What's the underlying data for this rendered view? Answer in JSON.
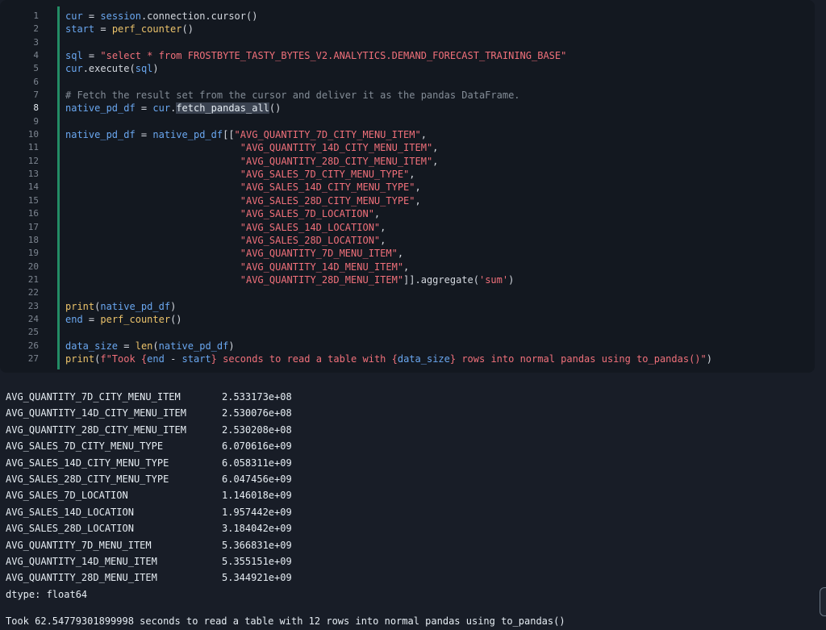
{
  "code_cell": {
    "line_numbers": [
      "1",
      "2",
      "3",
      "4",
      "5",
      "6",
      "7",
      "8",
      "9",
      "10",
      "11",
      "12",
      "13",
      "14",
      "15",
      "16",
      "17",
      "18",
      "19",
      "20",
      "21",
      "22",
      "23",
      "24",
      "25",
      "26",
      "27"
    ],
    "active_line": "8",
    "lines": [
      [
        {
          "t": "cur",
          "c": "var"
        },
        {
          "t": " = ",
          "c": "op"
        },
        {
          "t": "session",
          "c": "var"
        },
        {
          "t": ".connection.cursor()",
          "c": "op"
        }
      ],
      [
        {
          "t": "start",
          "c": "var"
        },
        {
          "t": " = ",
          "c": "op"
        },
        {
          "t": "perf_counter",
          "c": "fn"
        },
        {
          "t": "()",
          "c": "op"
        }
      ],
      [],
      [
        {
          "t": "sql",
          "c": "var"
        },
        {
          "t": " = ",
          "c": "op"
        },
        {
          "t": "\"select * from FROSTBYTE_TASTY_BYTES_V2.ANALYTICS.DEMAND_FORECAST_TRAINING_BASE\"",
          "c": "str"
        }
      ],
      [
        {
          "t": "cur",
          "c": "var"
        },
        {
          "t": ".execute(",
          "c": "op"
        },
        {
          "t": "sql",
          "c": "var"
        },
        {
          "t": ")",
          "c": "op"
        }
      ],
      [],
      [
        {
          "t": "# Fetch the result set from the cursor and deliver it as the pandas DataFrame.",
          "c": "cmt"
        }
      ],
      [
        {
          "t": "native_pd_df",
          "c": "var"
        },
        {
          "t": " = ",
          "c": "op"
        },
        {
          "t": "cur",
          "c": "var"
        },
        {
          "t": ".",
          "c": "op"
        },
        {
          "t": "fetch_pandas_all",
          "c": "hl"
        },
        {
          "t": "()",
          "c": "op"
        }
      ],
      [],
      [
        {
          "t": "native_pd_df",
          "c": "var"
        },
        {
          "t": " = ",
          "c": "op"
        },
        {
          "t": "native_pd_df",
          "c": "var"
        },
        {
          "t": "[[",
          "c": "op"
        },
        {
          "t": "\"AVG_QUANTITY_7D_CITY_MENU_ITEM\"",
          "c": "str"
        },
        {
          "t": ",",
          "c": "op"
        }
      ],
      [
        {
          "t": "                              ",
          "c": "op"
        },
        {
          "t": "\"AVG_QUANTITY_14D_CITY_MENU_ITEM\"",
          "c": "str"
        },
        {
          "t": ",",
          "c": "op"
        }
      ],
      [
        {
          "t": "                              ",
          "c": "op"
        },
        {
          "t": "\"AVG_QUANTITY_28D_CITY_MENU_ITEM\"",
          "c": "str"
        },
        {
          "t": ",",
          "c": "op"
        }
      ],
      [
        {
          "t": "                              ",
          "c": "op"
        },
        {
          "t": "\"AVG_SALES_7D_CITY_MENU_TYPE\"",
          "c": "str"
        },
        {
          "t": ",",
          "c": "op"
        }
      ],
      [
        {
          "t": "                              ",
          "c": "op"
        },
        {
          "t": "\"AVG_SALES_14D_CITY_MENU_TYPE\"",
          "c": "str"
        },
        {
          "t": ",",
          "c": "op"
        }
      ],
      [
        {
          "t": "                              ",
          "c": "op"
        },
        {
          "t": "\"AVG_SALES_28D_CITY_MENU_TYPE\"",
          "c": "str"
        },
        {
          "t": ",",
          "c": "op"
        }
      ],
      [
        {
          "t": "                              ",
          "c": "op"
        },
        {
          "t": "\"AVG_SALES_7D_LOCATION\"",
          "c": "str"
        },
        {
          "t": ",",
          "c": "op"
        }
      ],
      [
        {
          "t": "                              ",
          "c": "op"
        },
        {
          "t": "\"AVG_SALES_14D_LOCATION\"",
          "c": "str"
        },
        {
          "t": ",",
          "c": "op"
        }
      ],
      [
        {
          "t": "                              ",
          "c": "op"
        },
        {
          "t": "\"AVG_SALES_28D_LOCATION\"",
          "c": "str"
        },
        {
          "t": ",",
          "c": "op"
        }
      ],
      [
        {
          "t": "                              ",
          "c": "op"
        },
        {
          "t": "\"AVG_QUANTITY_7D_MENU_ITEM\"",
          "c": "str"
        },
        {
          "t": ",",
          "c": "op"
        }
      ],
      [
        {
          "t": "                              ",
          "c": "op"
        },
        {
          "t": "\"AVG_QUANTITY_14D_MENU_ITEM\"",
          "c": "str"
        },
        {
          "t": ",",
          "c": "op"
        }
      ],
      [
        {
          "t": "                              ",
          "c": "op"
        },
        {
          "t": "\"AVG_QUANTITY_28D_MENU_ITEM\"",
          "c": "str"
        },
        {
          "t": "]].aggregate(",
          "c": "op"
        },
        {
          "t": "'sum'",
          "c": "str"
        },
        {
          "t": ")",
          "c": "op"
        }
      ],
      [],
      [
        {
          "t": "print",
          "c": "fn"
        },
        {
          "t": "(",
          "c": "op"
        },
        {
          "t": "native_pd_df",
          "c": "var"
        },
        {
          "t": ")",
          "c": "op"
        }
      ],
      [
        {
          "t": "end",
          "c": "var"
        },
        {
          "t": " = ",
          "c": "op"
        },
        {
          "t": "perf_counter",
          "c": "fn"
        },
        {
          "t": "()",
          "c": "op"
        }
      ],
      [],
      [
        {
          "t": "data_size",
          "c": "var"
        },
        {
          "t": " = ",
          "c": "op"
        },
        {
          "t": "len",
          "c": "fn"
        },
        {
          "t": "(",
          "c": "op"
        },
        {
          "t": "native_pd_df",
          "c": "var"
        },
        {
          "t": ")",
          "c": "op"
        }
      ],
      [
        {
          "t": "print",
          "c": "fn"
        },
        {
          "t": "(",
          "c": "op"
        },
        {
          "t": "f\"Took {",
          "c": "str"
        },
        {
          "t": "end",
          "c": "var"
        },
        {
          "t": " - ",
          "c": "op"
        },
        {
          "t": "start",
          "c": "var"
        },
        {
          "t": "} seconds to read a table with {",
          "c": "str"
        },
        {
          "t": "data_size",
          "c": "var"
        },
        {
          "t": "} rows into normal pandas using to_pandas()\"",
          "c": "str"
        },
        {
          "t": ")",
          "c": "op"
        }
      ]
    ]
  },
  "output": {
    "rows": [
      {
        "name": "AVG_QUANTITY_7D_CITY_MENU_ITEM",
        "value": "2.533173e+08"
      },
      {
        "name": "AVG_QUANTITY_14D_CITY_MENU_ITEM",
        "value": "2.530076e+08"
      },
      {
        "name": "AVG_QUANTITY_28D_CITY_MENU_ITEM",
        "value": "2.530208e+08"
      },
      {
        "name": "AVG_SALES_7D_CITY_MENU_TYPE",
        "value": "6.070616e+09"
      },
      {
        "name": "AVG_SALES_14D_CITY_MENU_TYPE",
        "value": "6.058311e+09"
      },
      {
        "name": "AVG_SALES_28D_CITY_MENU_TYPE",
        "value": "6.047456e+09"
      },
      {
        "name": "AVG_SALES_7D_LOCATION",
        "value": "1.146018e+09"
      },
      {
        "name": "AVG_SALES_14D_LOCATION",
        "value": "1.957442e+09"
      },
      {
        "name": "AVG_SALES_28D_LOCATION",
        "value": "3.184042e+09"
      },
      {
        "name": "AVG_QUANTITY_7D_MENU_ITEM",
        "value": "5.366831e+09"
      },
      {
        "name": "AVG_QUANTITY_14D_MENU_ITEM",
        "value": "5.355151e+09"
      },
      {
        "name": "AVG_QUANTITY_28D_MENU_ITEM",
        "value": "5.344921e+09"
      }
    ],
    "dtype": "dtype: float64",
    "final_message": "Took 62.54779301899998 seconds to read a table with 12 rows into normal pandas using to_pandas()"
  },
  "colors": {
    "background": "#181d27",
    "cell_background": "#131820",
    "cell_bar": "#238c65",
    "variable": "#6aa7f0",
    "function": "#ecc36b",
    "string": "#f0707a",
    "comment": "#848d97"
  }
}
